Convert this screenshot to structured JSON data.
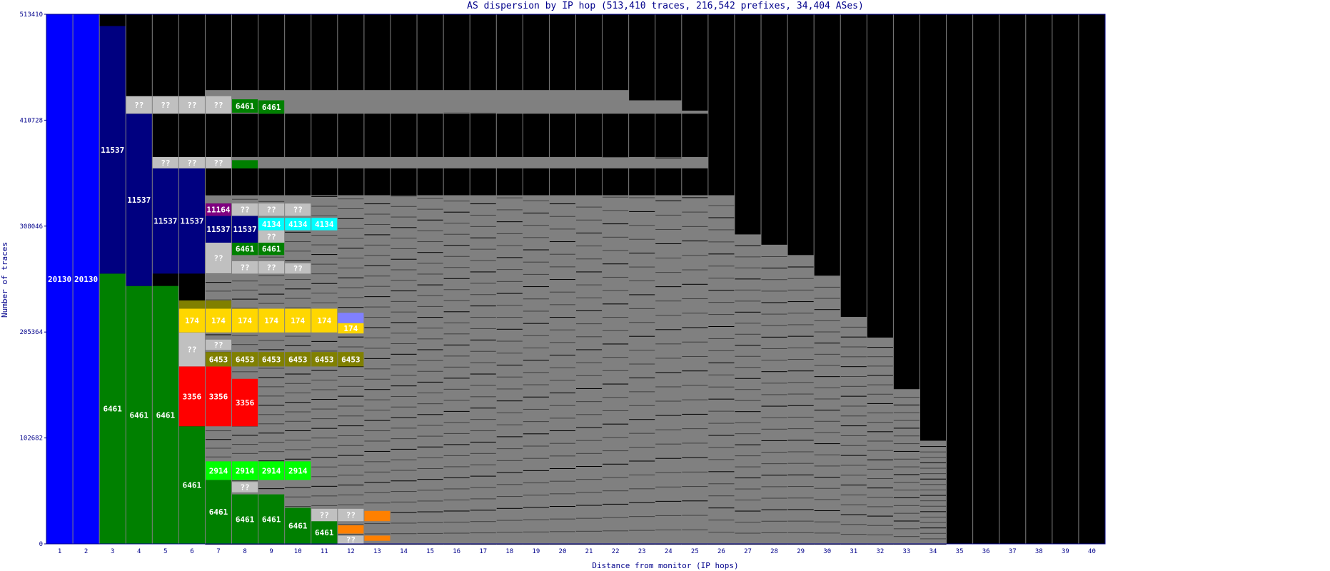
{
  "chart_data": {
    "type": "bar",
    "title": "AS dispersion by IP hop (513,410 traces, 216,542 prefixes, 34,404 ASes)",
    "xlabel": "Distance from monitor (IP hops)",
    "ylabel": "Number of traces",
    "ylim": [
      0,
      513410
    ],
    "yticks": [
      "0",
      "102682",
      "205364",
      "308046",
      "410728",
      "513410"
    ],
    "ytick_values": [
      0,
      102682,
      205364,
      308046,
      410728,
      513410
    ],
    "hops": [
      1,
      2,
      3,
      4,
      5,
      6,
      7,
      8,
      9,
      10,
      11,
      12,
      13,
      14,
      15,
      16,
      17,
      18,
      19,
      20,
      21,
      22,
      23,
      24,
      25,
      26,
      27,
      28,
      29,
      30,
      31,
      32,
      33,
      34,
      35,
      36,
      37,
      38,
      39,
      40
    ],
    "colors": {
      "blue": "#0000ff",
      "navy": "#000080",
      "green": "#008000",
      "lime": "#00ff00",
      "red": "#ff0000",
      "gold": "#ffd700",
      "olive": "#808000",
      "gray": "#808080",
      "silver": "#c0c0c0",
      "cyan": "#00ffff",
      "purple": "#800080",
      "magenta": "#ff00ff",
      "orange": "#ff8000",
      "darkred": "#800000",
      "tan": "#d2b48c",
      "periwinkle": "#8080ff",
      "dark": "#404040",
      "black": "#000000"
    },
    "segments": [
      {
        "hop": 1,
        "y0": 0,
        "y1": 513410,
        "color": "blue",
        "label": "20130"
      },
      {
        "hop": 2,
        "y0": 0,
        "y1": 513410,
        "color": "blue",
        "label": "20130"
      },
      {
        "hop": 3,
        "y0": 0,
        "y1": 262000,
        "color": "green",
        "label": "6461"
      },
      {
        "hop": 3,
        "y0": 262000,
        "y1": 502000,
        "color": "navy",
        "label": "11537"
      },
      {
        "hop": 4,
        "y0": 0,
        "y1": 250000,
        "color": "green",
        "label": "6461"
      },
      {
        "hop": 4,
        "y0": 250000,
        "y1": 417000,
        "color": "navy",
        "label": "11537"
      },
      {
        "hop": 4,
        "y0": 417000,
        "y1": 434000,
        "color": "silver",
        "label": "??"
      },
      {
        "hop": 5,
        "y0": 0,
        "y1": 250000,
        "color": "green",
        "label": "6461"
      },
      {
        "hop": 5,
        "y0": 262000,
        "y1": 364000,
        "color": "navy",
        "label": "11537"
      },
      {
        "hop": 5,
        "y0": 364000,
        "y1": 375000,
        "color": "silver",
        "label": "??"
      },
      {
        "hop": 5,
        "y0": 417000,
        "y1": 434000,
        "color": "silver",
        "label": "??"
      },
      {
        "hop": 6,
        "y0": 0,
        "y1": 114000,
        "color": "green",
        "label": "6461"
      },
      {
        "hop": 6,
        "y0": 114000,
        "y1": 172000,
        "color": "red",
        "label": "3356"
      },
      {
        "hop": 6,
        "y0": 172000,
        "y1": 205000,
        "color": "silver",
        "label": "??"
      },
      {
        "hop": 6,
        "y0": 205000,
        "y1": 228000,
        "color": "gold",
        "label": "174"
      },
      {
        "hop": 6,
        "y0": 228000,
        "y1": 236000,
        "color": "olive",
        "label": ""
      },
      {
        "hop": 6,
        "y0": 262000,
        "y1": 364000,
        "color": "navy",
        "label": "11537"
      },
      {
        "hop": 6,
        "y0": 364000,
        "y1": 375000,
        "color": "silver",
        "label": "??"
      },
      {
        "hop": 6,
        "y0": 417000,
        "y1": 434000,
        "color": "silver",
        "label": "??"
      },
      {
        "hop": 7,
        "y0": 0,
        "y1": 62000,
        "color": "green",
        "label": "6461"
      },
      {
        "hop": 7,
        "y0": 62000,
        "y1": 80000,
        "color": "lime",
        "label": "2914"
      },
      {
        "hop": 7,
        "y0": 114000,
        "y1": 172000,
        "color": "red",
        "label": "3356"
      },
      {
        "hop": 7,
        "y0": 172000,
        "y1": 186000,
        "color": "olive",
        "label": "6453"
      },
      {
        "hop": 7,
        "y0": 188000,
        "y1": 198000,
        "color": "silver",
        "label": "??"
      },
      {
        "hop": 7,
        "y0": 205000,
        "y1": 228000,
        "color": "gold",
        "label": "174"
      },
      {
        "hop": 7,
        "y0": 228000,
        "y1": 236000,
        "color": "olive",
        "label": ""
      },
      {
        "hop": 7,
        "y0": 262000,
        "y1": 292000,
        "color": "silver",
        "label": "??"
      },
      {
        "hop": 7,
        "y0": 292000,
        "y1": 318000,
        "color": "navy",
        "label": "11537"
      },
      {
        "hop": 7,
        "y0": 318000,
        "y1": 330000,
        "color": "purple",
        "label": "11164"
      },
      {
        "hop": 7,
        "y0": 364000,
        "y1": 375000,
        "color": "silver",
        "label": "??"
      },
      {
        "hop": 7,
        "y0": 417000,
        "y1": 434000,
        "color": "silver",
        "label": "??"
      },
      {
        "hop": 8,
        "y0": 0,
        "y1": 48000,
        "color": "green",
        "label": "6461"
      },
      {
        "hop": 8,
        "y0": 50000,
        "y1": 60000,
        "color": "silver",
        "label": "??"
      },
      {
        "hop": 8,
        "y0": 62000,
        "y1": 80000,
        "color": "lime",
        "label": "2914"
      },
      {
        "hop": 8,
        "y0": 114000,
        "y1": 160000,
        "color": "red",
        "label": "3356"
      },
      {
        "hop": 8,
        "y0": 172000,
        "y1": 186000,
        "color": "olive",
        "label": "6453"
      },
      {
        "hop": 8,
        "y0": 205000,
        "y1": 228000,
        "color": "gold",
        "label": "174"
      },
      {
        "hop": 8,
        "y0": 262000,
        "y1": 274000,
        "color": "silver",
        "label": "??"
      },
      {
        "hop": 8,
        "y0": 280000,
        "y1": 292000,
        "color": "green",
        "label": "6461"
      },
      {
        "hop": 8,
        "y0": 292000,
        "y1": 318000,
        "color": "navy",
        "label": "11537"
      },
      {
        "hop": 8,
        "y0": 318000,
        "y1": 330000,
        "color": "silver",
        "label": "??"
      },
      {
        "hop": 8,
        "y0": 364000,
        "y1": 372000,
        "color": "green",
        "label": ""
      },
      {
        "hop": 8,
        "y0": 418000,
        "y1": 431000,
        "color": "green",
        "label": "6461"
      },
      {
        "hop": 9,
        "y0": 0,
        "y1": 48000,
        "color": "green",
        "label": "6461"
      },
      {
        "hop": 9,
        "y0": 62000,
        "y1": 80000,
        "color": "lime",
        "label": "2914"
      },
      {
        "hop": 9,
        "y0": 172000,
        "y1": 186000,
        "color": "olive",
        "label": "6453"
      },
      {
        "hop": 9,
        "y0": 205000,
        "y1": 228000,
        "color": "gold",
        "label": "174"
      },
      {
        "hop": 9,
        "y0": 262000,
        "y1": 274000,
        "color": "silver",
        "label": "??"
      },
      {
        "hop": 9,
        "y0": 280000,
        "y1": 292000,
        "color": "green",
        "label": "6461"
      },
      {
        "hop": 9,
        "y0": 292000,
        "y1": 304000,
        "color": "silver",
        "label": "??"
      },
      {
        "hop": 9,
        "y0": 304000,
        "y1": 316000,
        "color": "cyan",
        "label": "4134"
      },
      {
        "hop": 9,
        "y0": 318000,
        "y1": 330000,
        "color": "silver",
        "label": "??"
      },
      {
        "hop": 9,
        "y0": 417000,
        "y1": 430000,
        "color": "green",
        "label": "6461"
      },
      {
        "hop": 10,
        "y0": 0,
        "y1": 35000,
        "color": "green",
        "label": "6461"
      },
      {
        "hop": 10,
        "y0": 62000,
        "y1": 80000,
        "color": "lime",
        "label": "2914"
      },
      {
        "hop": 10,
        "y0": 172000,
        "y1": 186000,
        "color": "olive",
        "label": "6453"
      },
      {
        "hop": 10,
        "y0": 205000,
        "y1": 228000,
        "color": "gold",
        "label": "174"
      },
      {
        "hop": 10,
        "y0": 262000,
        "y1": 272000,
        "color": "silver",
        "label": "??"
      },
      {
        "hop": 10,
        "y0": 304000,
        "y1": 316000,
        "color": "cyan",
        "label": "4134"
      },
      {
        "hop": 10,
        "y0": 318000,
        "y1": 330000,
        "color": "silver",
        "label": "??"
      },
      {
        "hop": 11,
        "y0": 0,
        "y1": 22000,
        "color": "green",
        "label": "6461"
      },
      {
        "hop": 11,
        "y0": 22000,
        "y1": 34000,
        "color": "silver",
        "label": "??"
      },
      {
        "hop": 11,
        "y0": 172000,
        "y1": 186000,
        "color": "olive",
        "label": "6453"
      },
      {
        "hop": 11,
        "y0": 205000,
        "y1": 228000,
        "color": "gold",
        "label": "174"
      },
      {
        "hop": 11,
        "y0": 304000,
        "y1": 316000,
        "color": "cyan",
        "label": "4134"
      },
      {
        "hop": 12,
        "y0": 0,
        "y1": 8000,
        "color": "silver",
        "label": "??"
      },
      {
        "hop": 12,
        "y0": 10000,
        "y1": 18000,
        "color": "orange",
        "label": ""
      },
      {
        "hop": 12,
        "y0": 22000,
        "y1": 34000,
        "color": "silver",
        "label": "??"
      },
      {
        "hop": 12,
        "y0": 172000,
        "y1": 186000,
        "color": "olive",
        "label": "6453"
      },
      {
        "hop": 12,
        "y0": 204000,
        "y1": 214000,
        "color": "gold",
        "label": "174"
      },
      {
        "hop": 12,
        "y0": 214000,
        "y1": 224000,
        "color": "periwinkle",
        "label": ""
      },
      {
        "hop": 13,
        "y0": 22000,
        "y1": 32000,
        "color": "orange",
        "label": ""
      },
      {
        "hop": 13,
        "y0": 3000,
        "y1": 8000,
        "color": "orange",
        "label": ""
      }
    ]
  }
}
